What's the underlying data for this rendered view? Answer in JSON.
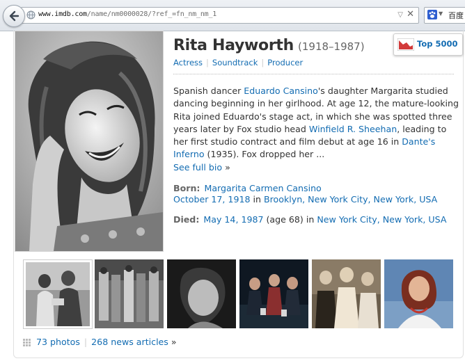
{
  "browser": {
    "url_host": "www.imdb.com",
    "url_path": "/name/nm0000028/?ref_=fn_nm_nm_1",
    "search_engine_label": "百度"
  },
  "person": {
    "name": "Rita Hayworth",
    "years": "(1918–1987)",
    "professions": [
      "Actress",
      "Soundtrack",
      "Producer"
    ]
  },
  "badge": {
    "label": "Top 5000"
  },
  "bio": {
    "t1": "Spanish dancer ",
    "l1": "Eduardo Cansino",
    "t2": "'s daughter Margarita studied dancing beginning in her girlhood. At age 12, the mature-looking Rita joined Eduardo's stage act, in which she was spotted three years later by Fox studio head ",
    "l2": "Winfield R. Sheehan",
    "t3": ", leading to her first studio contract and film debut at age 16 in ",
    "l3": "Dante's Inferno",
    "t4": " (1935). Fox dropped her ...",
    "see_full_bio": "See full bio",
    "raquo": "»"
  },
  "born": {
    "label": "Born:",
    "birth_name": "Margarita Carmen Cansino",
    "date": "October 17, 1918",
    "in_word": "in",
    "place": "Brooklyn, New York City, New York, USA"
  },
  "died": {
    "label": "Died:",
    "date": "May 14, 1987",
    "age_text": "(age 68) in",
    "place": "New York City, New York, USA"
  },
  "footer": {
    "photos": "73 photos",
    "news": "268 news articles",
    "raquo": "»"
  },
  "colors": {
    "link": "#136cb2",
    "text": "#333333",
    "muted": "#666666"
  }
}
